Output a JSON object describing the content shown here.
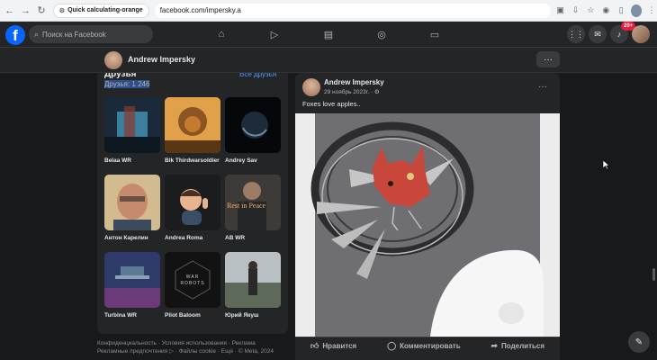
{
  "browser": {
    "back": "←",
    "forward": "→",
    "reload": "↻",
    "site_info": "⚙",
    "tab_chip": "Quick calculating-orange",
    "url": "facebook.com/impersky.a"
  },
  "facebook_bar": {
    "logo": "f",
    "search_placeholder": "Поиск на Facebook",
    "notification_count": "20+"
  },
  "profile_subbar": {
    "name": "Andrew Impersky",
    "more": "···"
  },
  "friends_panel": {
    "title": "Друзья",
    "see_all": "Все друзья",
    "count": "Друзья: 1 246",
    "friends": [
      {
        "name": "Belaa WR"
      },
      {
        "name": "Blk Thirdwarsoldier"
      },
      {
        "name": "Andrey Sav"
      },
      {
        "name": "Антон Карелин"
      },
      {
        "name": "Andrea Roma"
      },
      {
        "name": "AB WR",
        "photo_caption": "Rest in Peace"
      },
      {
        "name": "Turbina WR"
      },
      {
        "name": "Pilot Baloom",
        "photo_caption": "WAR ROBOTS"
      },
      {
        "name": "Юрий Якуш"
      }
    ]
  },
  "footer": {
    "line1": "Конфиденциальность · Условия использования · Реклама",
    "line2": "Рекламные предпочтения ▷ · Файлы cookie · Ещё · © Meta, 2024"
  },
  "post": {
    "author": "Andrew Impersky",
    "date": "29 ноябрь 2023г. · ⚙",
    "more": "···",
    "text": "Foxes love apples..",
    "actions": {
      "like": "Нравится",
      "comment": "Комментировать",
      "share": "Поделиться"
    }
  }
}
